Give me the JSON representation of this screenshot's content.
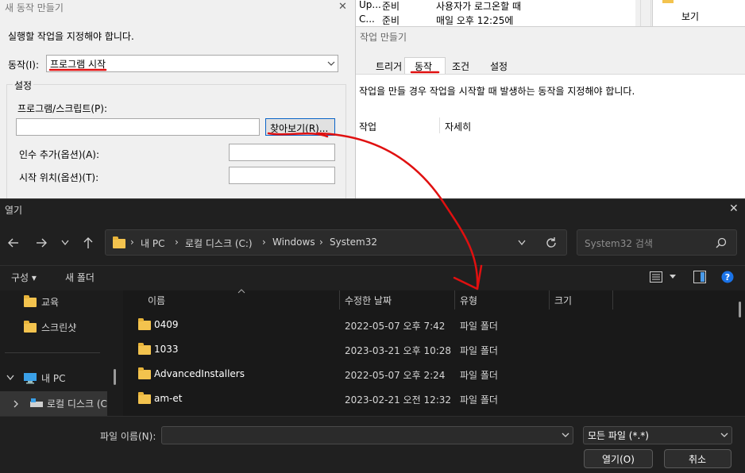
{
  "background_list": {
    "row1": {
      "name": "Up...",
      "status": "준비",
      "trigger": "사용자가 로그온할 때"
    },
    "row2": {
      "name": "C...",
      "status": "준비",
      "trigger": "매일 오후 12:25에"
    },
    "side_item": "보기"
  },
  "task_window": {
    "title": "작업 만들기",
    "tabs": [
      "트리거",
      "동작",
      "조건",
      "설정"
    ],
    "description": "작업을 만들 경우 작업을 시작할 때 발생하는 동작을 지정해야 합니다.",
    "col_action": "작업",
    "col_details": "자세히"
  },
  "new_action_dialog": {
    "title": "새 동작 만들기",
    "instruction": "실행할 작업을 지정해야 합니다.",
    "action_label": "동작(I):",
    "action_value": "프로그램 시작",
    "group_label": "설정",
    "program_label": "프로그램/스크립트(P):",
    "program_value": "",
    "browse_label": "찾아보기(R)...",
    "args_label": "인수 추가(옵션)(A):",
    "startin_label": "시작 위치(옵션)(T):",
    "close_glyph": "✕"
  },
  "open_dialog": {
    "title": "열기",
    "close_glyph": "✕",
    "breadcrumb": [
      "내 PC",
      "로컬 디스크 (C:)",
      "Windows",
      "System32"
    ],
    "search_placeholder": "System32 검색",
    "organize_label": "구성 ▾",
    "new_folder_label": "새 폴더",
    "nav_items": [
      "교육",
      "스크린샷"
    ],
    "nav_pc": "내 PC",
    "nav_disk": "로컬 디스크 (C",
    "columns": {
      "name": "이름",
      "modified": "수정한 날짜",
      "type": "유형",
      "size": "크기"
    },
    "files": [
      {
        "name": "0409",
        "modified": "2022-05-07 오후 7:42",
        "type": "파일 폴더"
      },
      {
        "name": "1033",
        "modified": "2023-03-21 오후 10:28",
        "type": "파일 폴더"
      },
      {
        "name": "AdvancedInstallers",
        "modified": "2022-05-07 오후 2:24",
        "type": "파일 폴더"
      },
      {
        "name": "am-et",
        "modified": "2023-02-21 오전 12:32",
        "type": "파일 폴더"
      }
    ],
    "filename_label": "파일 이름(N):",
    "filename_value": "",
    "filetype_value": "모든 파일 (*.*)",
    "open_label": "열기(O)",
    "cancel_label": "취소"
  },
  "colors": {
    "annotation_red": "#e01010",
    "folder_yellow": "#f3c34e",
    "dark_bg": "#202020",
    "accent_blue": "#0a64c8"
  }
}
